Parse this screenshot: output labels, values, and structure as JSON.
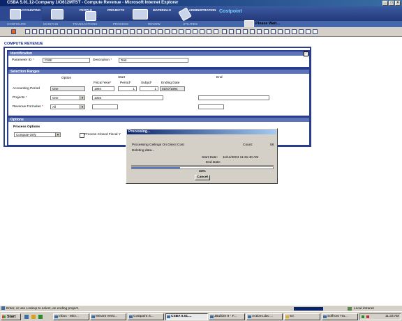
{
  "window": {
    "title": "CSBA 5.01.12-Company 1/O612MTST - Compute Revenue - Microsoft Internet Explorer"
  },
  "header": {
    "modules": [
      {
        "label": "ACCOUNTING",
        "icon": "accounting-icon"
      },
      {
        "label": "PEOPLE",
        "icon": "people-icon"
      },
      {
        "label": "PROJECTS",
        "icon": "projects-icon"
      },
      {
        "label": "MATERIALS",
        "icon": "materials-icon"
      },
      {
        "label": "ADMINISTRATION",
        "icon": "administration-icon"
      }
    ],
    "brand": "Costpoint",
    "subnav": [
      "CONFIGURE",
      "MAINTAIN",
      "TRANSACTIONS",
      "PROCESS",
      "REVIEW",
      "UTILITIES"
    ],
    "please_wait": "Please Wait..."
  },
  "page_title": "COMPUTE REVENUE",
  "identification": {
    "header": "Identification",
    "parameter_id_label": "Parameter ID",
    "parameter_id_value": "CSBI",
    "description_label": "Description",
    "description_value": "Test"
  },
  "selection": {
    "header": "Selection Ranges",
    "option_col": "Option",
    "start_col": "Start",
    "end_col": "End",
    "fiscal_year_label": "Fiscal Year",
    "period_label": "Period",
    "subpd_label": "Subpd",
    "ending_date_label": "Ending Date",
    "accounting_period_label": "Accounting Period",
    "accounting_period_option": "One",
    "fiscal_year_value": "1994",
    "period_value": "1",
    "subpd_value": "1",
    "ending_date_value": "01/07/1994",
    "projects_label": "Projects",
    "projects_option": "One",
    "projects_start": "1003",
    "revenue_formulas_label": "Revenue Formulas",
    "revenue_formulas_option": "All"
  },
  "options": {
    "header": "Options",
    "process_options_label": "Process Options",
    "process_options_value": "Compute Only",
    "process_closed_label": "Process Closed Fiscal Y"
  },
  "dialog": {
    "title": "Processing...",
    "message": "Processing Ceilings On Direct Cost",
    "count_label": "Count:",
    "count_value": "58",
    "status": "Deleting data...",
    "start_date_label": "Start Date:",
    "start_date_value": "11/11/2004 11:31:40 AM",
    "end_date_label": "End Date:",
    "end_date_value": "",
    "progress_percent": 34,
    "progress_text": "34%",
    "cancel_label": "Cancel"
  },
  "statusbar": {
    "message": "Enter, or use Lookup to select, an ending project.",
    "zone": "Local intranet"
  },
  "taskbar": {
    "start_label": "Start",
    "tasks": [
      "Inbox - Micr...",
      "Merant Versi...",
      "Costpoint S...",
      "CSBA 5.01....",
      "JBuilder 9 - F...",
      "Actions.doc ...",
      "src",
      "Soffront Tra..."
    ],
    "clock": "11:33 AM"
  },
  "colors": {
    "accent": "#2a3c8c",
    "group_header": "#5d74b8",
    "titlebar": "#0a246a"
  }
}
